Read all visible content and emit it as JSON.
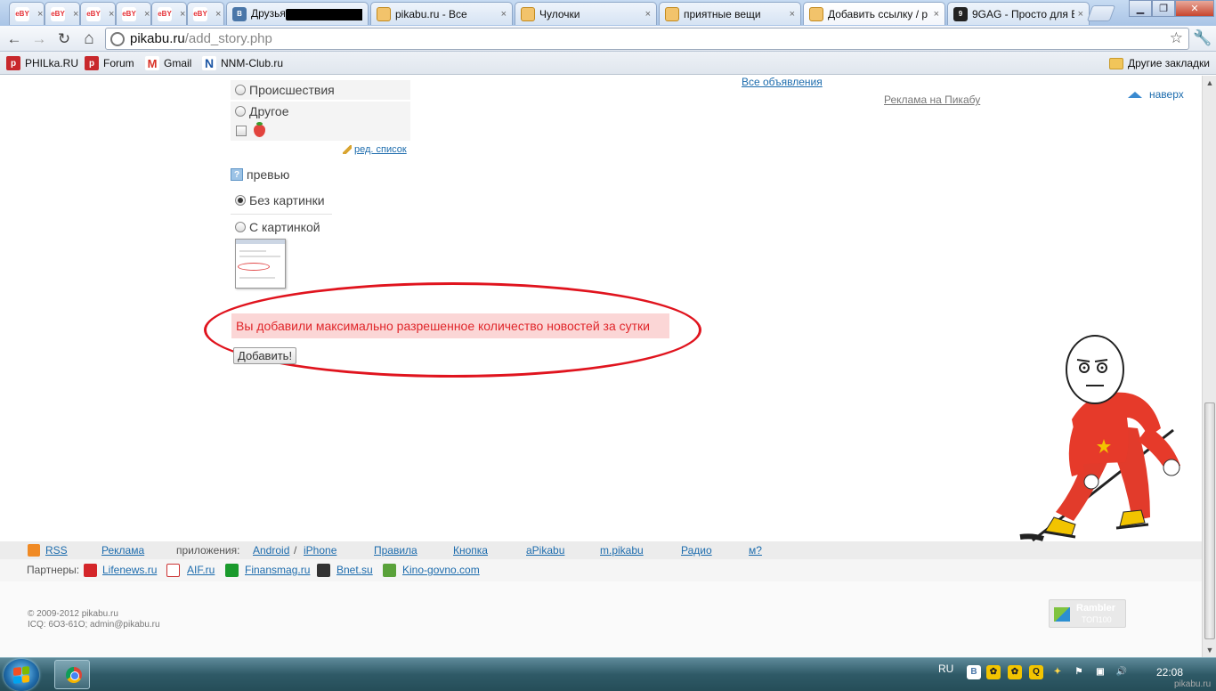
{
  "tabs": [
    {
      "fav": "eBY",
      "favtype": "ebay",
      "title": ""
    },
    {
      "fav": "eBY",
      "favtype": "ebay",
      "title": ""
    },
    {
      "fav": "eBY",
      "favtype": "ebay",
      "title": ""
    },
    {
      "fav": "eBY",
      "favtype": "ebay",
      "title": ""
    },
    {
      "fav": "eBY",
      "favtype": "ebay",
      "title": ""
    },
    {
      "fav": "eBY",
      "favtype": "ebay",
      "title": ""
    },
    {
      "fav": "В",
      "favtype": "vk",
      "title": "Друзья"
    },
    {
      "fav": "",
      "favtype": "pk",
      "title": "pikabu.ru - Все"
    },
    {
      "fav": "",
      "favtype": "pk",
      "title": "Чулочки"
    },
    {
      "fav": "",
      "favtype": "pk",
      "title": "приятные вещи"
    },
    {
      "fav": "",
      "favtype": "pk",
      "title": "Добавить ссылку / р"
    },
    {
      "fav": "9",
      "favtype": "9",
      "title": "9GAG - Просто для В"
    }
  ],
  "toolbar": {
    "back": "←",
    "forward": "→",
    "reload": "↻",
    "home": "⌂",
    "url_host": "pikabu.ru",
    "url_path": "/add_story.php",
    "star": "☆",
    "wrench": "🔧"
  },
  "bookmarks": [
    {
      "label": "PHILka.RU",
      "icon": "p"
    },
    {
      "label": "Forum",
      "icon": "p"
    },
    {
      "label": "Gmail",
      "icon": "M"
    },
    {
      "label": "NNM-Club.ru",
      "icon": "N"
    }
  ],
  "other_bookmarks": "Другие закладки",
  "form": {
    "categories": [
      "Происшествия",
      "Другое"
    ],
    "edit_list": "ред. список",
    "preview": "превью",
    "preview_icon": "?",
    "no_image": "Без картинки",
    "with_image": "С картинкой",
    "error": "Вы добавили максимально разрешенное количество новостей за сутки",
    "submit": "Добавить!"
  },
  "side": {
    "all_ads": "Все объявления",
    "advert": "Реклама на Пикабу",
    "to_top": "наверх"
  },
  "footer": {
    "rss": "RSS",
    "advert": "Реклама",
    "apps_label": "приложения:",
    "android": "Android",
    "slash": "/",
    "iphone": "iPhone",
    "rules": "Правила",
    "button": "Кнопка",
    "apikabu": "aPikabu",
    "mpikabu": "m.pikabu",
    "radio": "Радио",
    "m": "м?",
    "partners_label": "Партнеры:",
    "partners": [
      "Lifenews.ru",
      "AIF.ru",
      "Finansmag.ru",
      "Bnet.su",
      "Kino-govno.com"
    ],
    "copyright": "© 2009-2012 pikabu.ru",
    "contacts": "ICQ: 6O3-61O; admin@pikabu.ru",
    "rambler_title": "Rambler",
    "rambler_sub": "ТОП100"
  },
  "taskbar": {
    "lang": "RU",
    "time": "22:08"
  },
  "watermark": "pikabu.ru",
  "colors": {
    "error_text": "#e0262a",
    "error_bg": "#fbd6d6",
    "ellipse": "#e0141e",
    "link": "#1d6cad"
  }
}
